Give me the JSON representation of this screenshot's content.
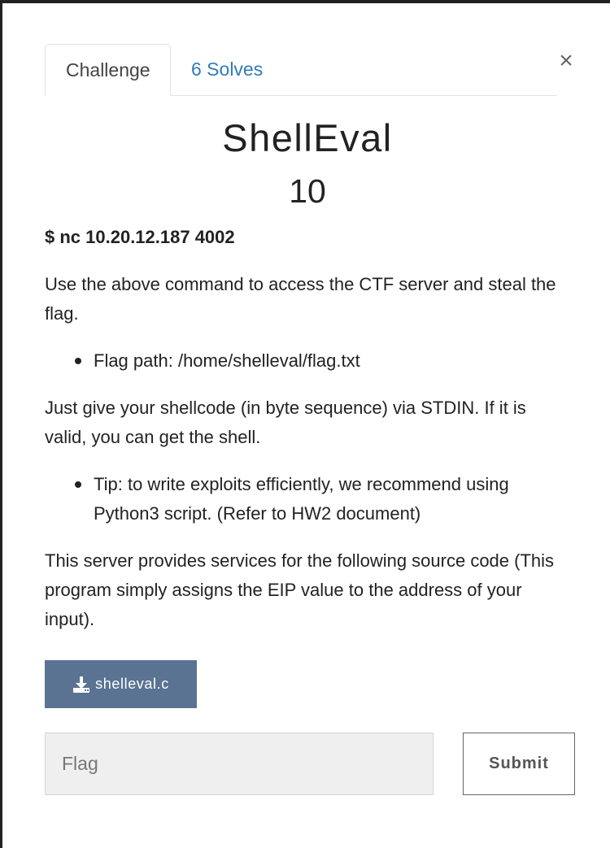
{
  "tabs": [
    {
      "label": "Challenge"
    },
    {
      "label": "6 Solves"
    }
  ],
  "close_label": "×",
  "challenge": {
    "name": "ShellEval",
    "points": "10",
    "command": "$ nc 10.20.12.187 4002",
    "intro": "Use the above command to access the CTF server and steal the flag.",
    "bullet1": "Flag path: /home/shelleval/flag.txt",
    "para2": "Just give your shellcode (in byte sequence) via STDIN. If it is valid, you can get the shell.",
    "bullet2": "Tip: to write exploits efficiently, we recommend using Python3 script. (Refer to HW2 document)",
    "para3": "This server provides services for the following source code (This program simply assigns the EIP value to the address of your input).",
    "file_label": "shelleval.c"
  },
  "form": {
    "flag_placeholder": "Flag",
    "submit_label": "Submit"
  },
  "colors": {
    "tab_link": "#337ab7",
    "download_button": "#5a7392"
  },
  "icons": {
    "close": "close-icon",
    "download": "download-icon"
  }
}
